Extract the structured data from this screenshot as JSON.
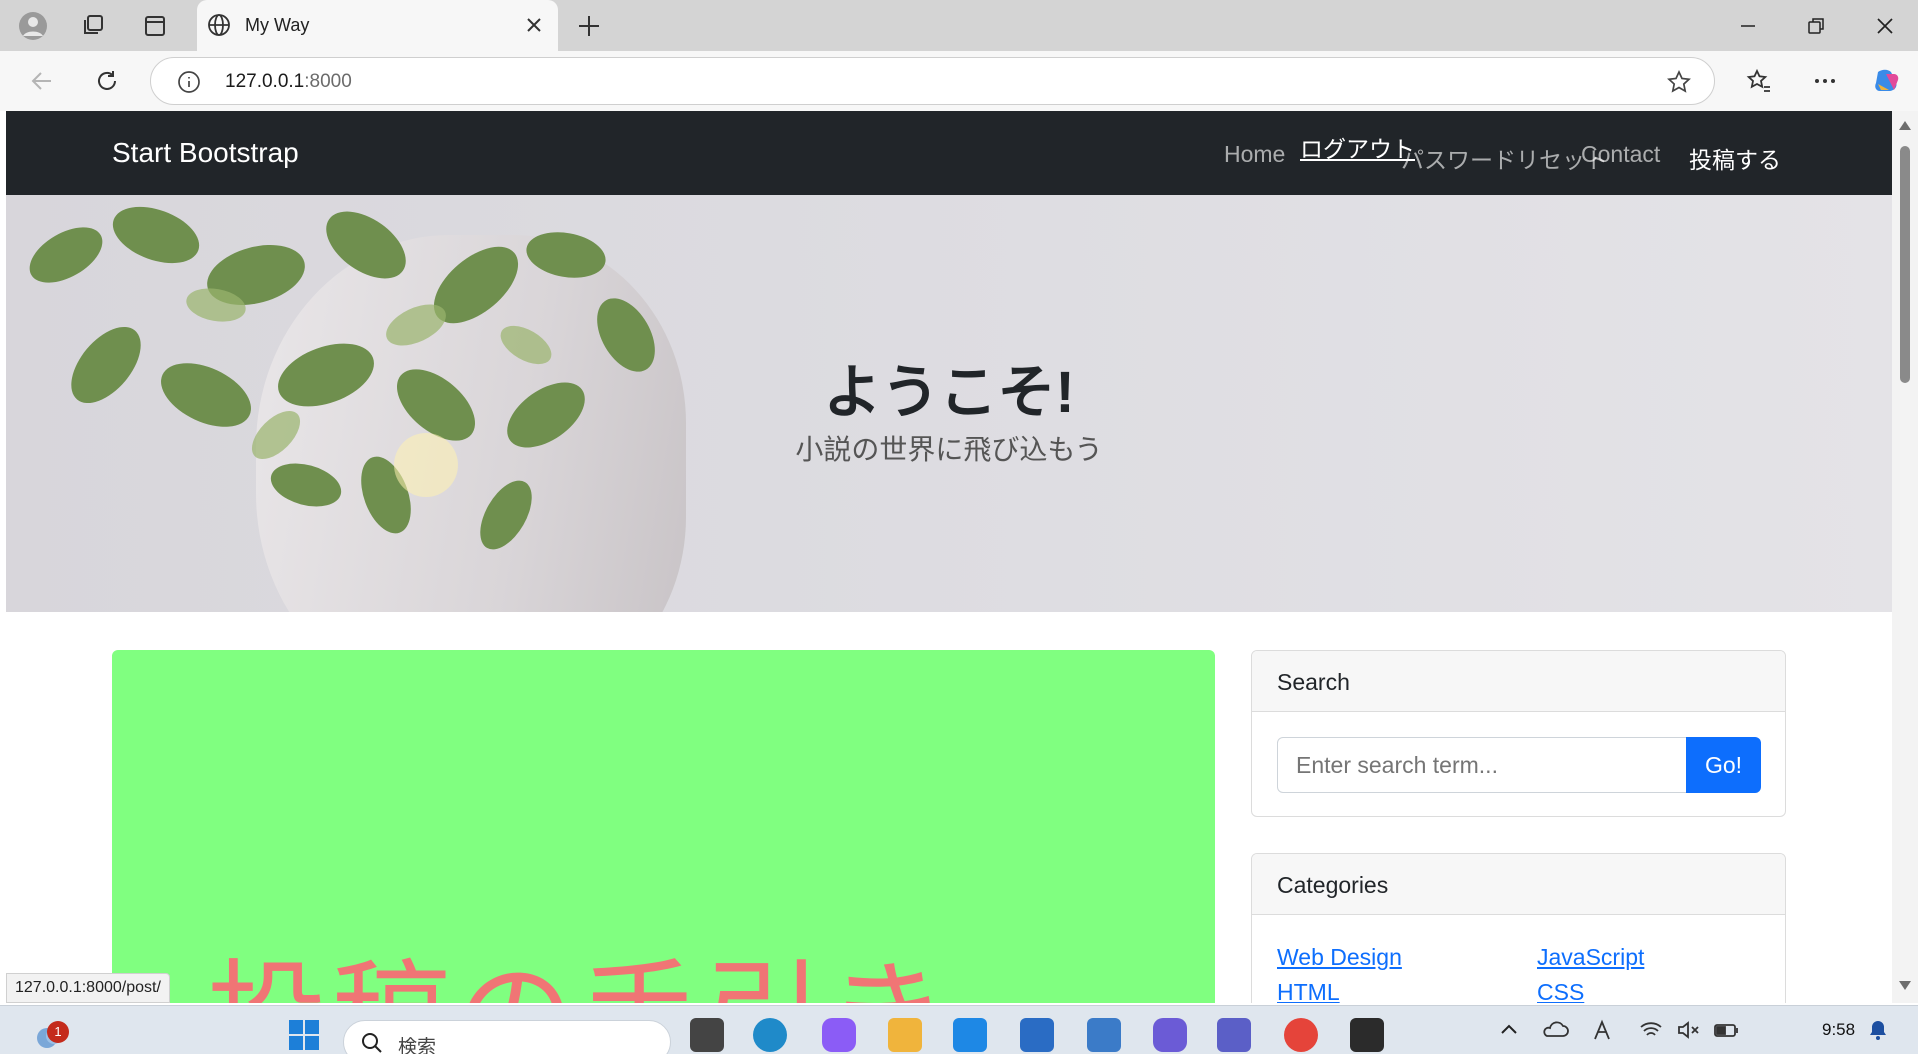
{
  "browser": {
    "tab_title": "My Way",
    "address_host": "127.0.0.1",
    "address_port": ":8000",
    "status_url": "127.0.0.1:8000/post/"
  },
  "site": {
    "brand": "Start Bootstrap",
    "nav": {
      "home": "Home",
      "logout": "ログアウト",
      "password_reset": "パスワードリセット",
      "contact": "Contact",
      "post": "投稿する"
    },
    "hero_title": "ようこそ!",
    "hero_subtitle": "小説の世界に飛び込もう",
    "featured_post_image_text": "投稿の手引き",
    "search": {
      "heading": "Search",
      "placeholder": "Enter search term...",
      "button": "Go!"
    },
    "categories": {
      "heading": "Categories",
      "items": [
        "Web Design",
        "JavaScript",
        "HTML",
        "CSS"
      ]
    }
  },
  "taskbar": {
    "search_placeholder": "検索",
    "time": "9:58",
    "notification_count": "1"
  },
  "colors": {
    "navbar": "#212529",
    "link": "#0d6efd",
    "post_bg": "#80ff80",
    "post_text": "#f07575"
  }
}
